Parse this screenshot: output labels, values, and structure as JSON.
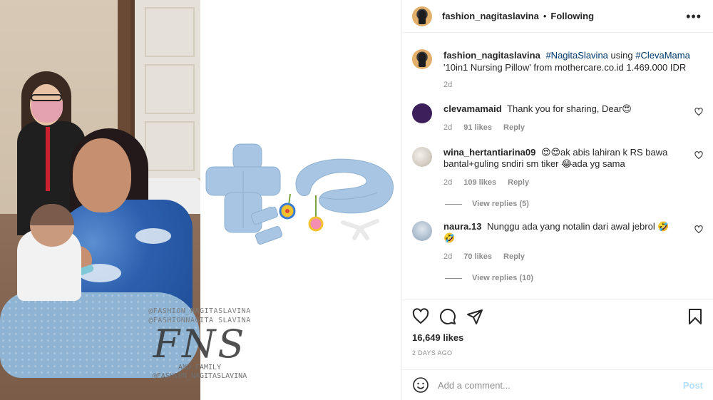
{
  "header": {
    "username": "fashion_nagitaslavina",
    "separator": "•",
    "follow_status": "Following",
    "more_icon": "more-horizontal-icon"
  },
  "caption": {
    "username": "fashion_nagitaslavina",
    "hashtag1": "#NagitaSlavina",
    "text1": "using",
    "hashtag2": "#ClevaMama",
    "text2": "'10in1 Nursing Pillow' from mothercare.co.id 1.469.000 IDR",
    "time": "2d"
  },
  "comments": [
    {
      "username": "clevamamaid",
      "text": "Thank you for sharing, Dear😍",
      "time": "2d",
      "likes": "91 likes",
      "reply": "Reply",
      "avatar_color": "#3d1f5c"
    },
    {
      "username": "wina_hertantiarina09",
      "text": "😍😍ak abis lahiran k RS bawa bantal+guling sndiri sm tiker 😂ada yg sama",
      "time": "2d",
      "likes": "109 likes",
      "reply": "Reply",
      "view_replies": "View replies (5)",
      "avatar_color": "#c9c2b6"
    },
    {
      "username": "naura.13",
      "text": "Nunggu ada yang notalin dari awal jebrol 🤣🤣",
      "time": "2d",
      "likes": "70 likes",
      "reply": "Reply",
      "view_replies": "View replies (10)",
      "avatar_color": "#a9b9c9"
    }
  ],
  "actions": {
    "like_icon": "heart-icon",
    "comment_icon": "comment-icon",
    "share_icon": "share-icon",
    "save_icon": "bookmark-icon",
    "likes": "16,649 likes",
    "date": "2 DAYS AGO"
  },
  "add_comment": {
    "emoji_icon": "emoji-icon",
    "placeholder": "Add a comment...",
    "post_label": "Post"
  },
  "watermark": {
    "line1": "@FASHION_NAGITASLAVINA",
    "line2": "@FASHIONNAGITA SLAVINA",
    "logo": "FNS",
    "line3": "AND FAMILY",
    "line4": "@FASHION_NAGITASLAVINA"
  },
  "colors": {
    "link": "#00376b",
    "muted": "#8e8e8e",
    "post_disabled": "#b2dffc",
    "pillow_blue": "#a8c6e3"
  }
}
